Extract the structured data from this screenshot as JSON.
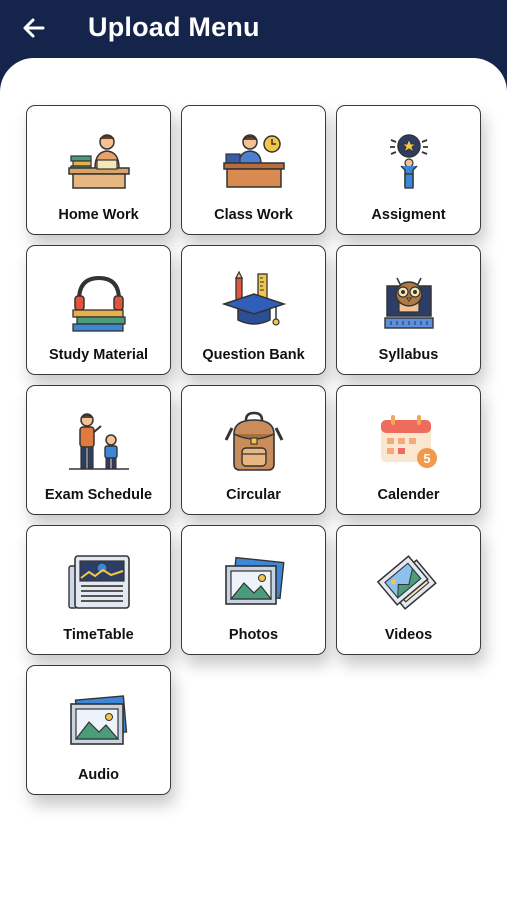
{
  "header": {
    "title": "Upload Menu",
    "back_icon": "arrow-left-icon",
    "background": "#15244a"
  },
  "menu": {
    "items": [
      {
        "label": "Home Work",
        "icon": "teacher-desk-books-icon"
      },
      {
        "label": "Class Work",
        "icon": "teacher-at-desk-clock-icon"
      },
      {
        "label": "Assigment",
        "icon": "idea-bulb-person-icon"
      },
      {
        "label": "Study Material",
        "icon": "headphones-books-icon"
      },
      {
        "label": "Question Bank",
        "icon": "graduation-cap-pencils-icon"
      },
      {
        "label": "Syllabus",
        "icon": "owl-computer-icon"
      },
      {
        "label": "Exam Schedule",
        "icon": "teacher-student-icon"
      },
      {
        "label": "Circular",
        "icon": "backpack-icon"
      },
      {
        "label": "Calender",
        "icon": "calendar-icon"
      },
      {
        "label": "TimeTable",
        "icon": "newspaper-icon"
      },
      {
        "label": "Photos",
        "icon": "photos-icon"
      },
      {
        "label": "Videos",
        "icon": "video-frames-icon"
      },
      {
        "label": "Audio",
        "icon": "image-frame-icon"
      }
    ]
  }
}
